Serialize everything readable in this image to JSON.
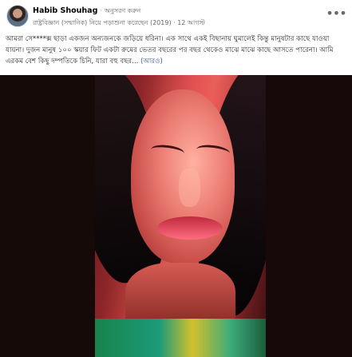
{
  "header": {
    "author": "Habib Shouhag",
    "separator": "·",
    "follow": "অনুসরণ করুন",
    "meta": "রাষ্ট্রবিজ্ঞান (সম্মানিক) নিয়ে পড়াশুনা করেছেন (2019) · 12 আগস্ট",
    "more_icon": "more-horizontal-icon"
  },
  "post": {
    "text": "আমরা সে****ক্স ছাড়া একজন অন্যজনকে জড়িয়ে ধরিনা। এক সাথে একই বিছানায় ঘুমালেই কিন্তু মানুষটার কাছে যাওয়া যায়না। দুজন মানুষ ১০০ স্কয়ার ফিট একটা রুমের ভেতর বছরের পর বছর থেকেও মাঝে মাঝে কাছে আসতে পারেনা। আমি এরকম বেশ কিছু দম্পতিকে চিনি, যারা বহু বছর...",
    "see_more": "(আরও)"
  },
  "photo": {
    "description_icon": "portrait-photo"
  }
}
